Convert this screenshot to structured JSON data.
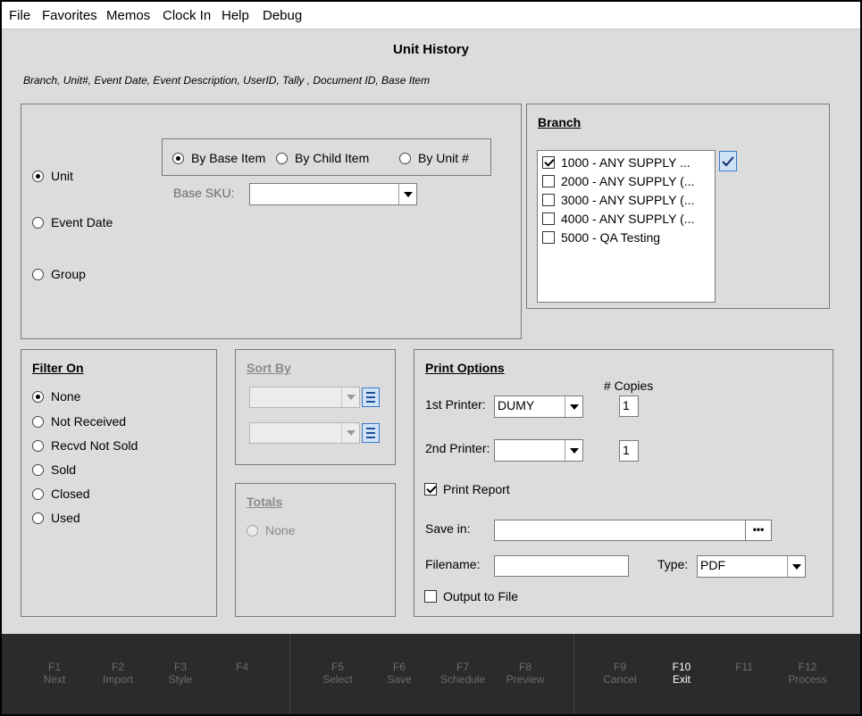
{
  "menu": [
    "File",
    "Favorites",
    "Memos",
    "Clock In",
    "Help",
    "Debug"
  ],
  "title": "Unit History",
  "columns_note": "Branch, Unit#, Event Date, Event Description, UserID, Tally , Document ID, Base Item",
  "selection": {
    "options": [
      {
        "label": "Unit",
        "selected": true
      },
      {
        "label": "Event Date",
        "selected": false
      },
      {
        "label": "Group",
        "selected": false
      }
    ],
    "item_types": [
      {
        "label": "By Base Item",
        "selected": true
      },
      {
        "label": "By Child Item",
        "selected": false
      },
      {
        "label": "By Unit #",
        "selected": false
      }
    ],
    "base_sku_label": "Base SKU:",
    "base_sku_value": ""
  },
  "branch": {
    "heading": "Branch",
    "items": [
      {
        "label": "1000 - ANY SUPPLY ...",
        "checked": true
      },
      {
        "label": "2000 - ANY SUPPLY (...",
        "checked": false
      },
      {
        "label": "3000 - ANY SUPPLY (...",
        "checked": false
      },
      {
        "label": "4000 - ANY SUPPLY (...",
        "checked": false
      },
      {
        "label": "5000 - QA Testing",
        "checked": false
      }
    ]
  },
  "filter": {
    "heading": "Filter On",
    "options": [
      {
        "label": "None",
        "selected": true
      },
      {
        "label": "Not Received",
        "selected": false
      },
      {
        "label": "Recvd Not Sold",
        "selected": false
      },
      {
        "label": "Sold",
        "selected": false
      },
      {
        "label": "Closed",
        "selected": false
      },
      {
        "label": "Used",
        "selected": false
      }
    ]
  },
  "sort": {
    "heading": "Sort By",
    "field1": "",
    "field2": ""
  },
  "totals": {
    "heading": "Totals",
    "option": "None"
  },
  "print": {
    "heading": "Print Options",
    "copies_label": "# Copies",
    "printer1_label": "1st Printer:",
    "printer1_value": "DUMY",
    "copies1": "1",
    "printer2_label": "2nd Printer:",
    "printer2_value": "",
    "copies2": "1",
    "print_report_label": "Print Report",
    "print_report_checked": true,
    "save_in_label": "Save in:",
    "save_in_value": "",
    "browse_label": "•••",
    "filename_label": "Filename:",
    "filename_value": "",
    "type_label": "Type:",
    "type_value": "PDF",
    "output_to_file_label": "Output to File",
    "output_to_file_checked": false
  },
  "function_keys": [
    {
      "key": "F1",
      "label": "Next",
      "active": false
    },
    {
      "key": "F2",
      "label": "Import",
      "active": false
    },
    {
      "key": "F3",
      "label": "Style",
      "active": false
    },
    {
      "key": "F4",
      "label": "",
      "active": false
    },
    {
      "key": "F5",
      "label": "Select",
      "active": false
    },
    {
      "key": "F6",
      "label": "Save",
      "active": false
    },
    {
      "key": "F7",
      "label": "Schedule",
      "active": false
    },
    {
      "key": "F8",
      "label": "Preview",
      "active": false
    },
    {
      "key": "F9",
      "label": "Cancel",
      "active": false
    },
    {
      "key": "F10",
      "label": "Exit",
      "active": true
    },
    {
      "key": "F11",
      "label": "",
      "active": false
    },
    {
      "key": "F12",
      "label": "Process",
      "active": false
    }
  ],
  "colors": {
    "accent_blue": "#cfe3f8",
    "function_bar": "#2b2b2b"
  }
}
